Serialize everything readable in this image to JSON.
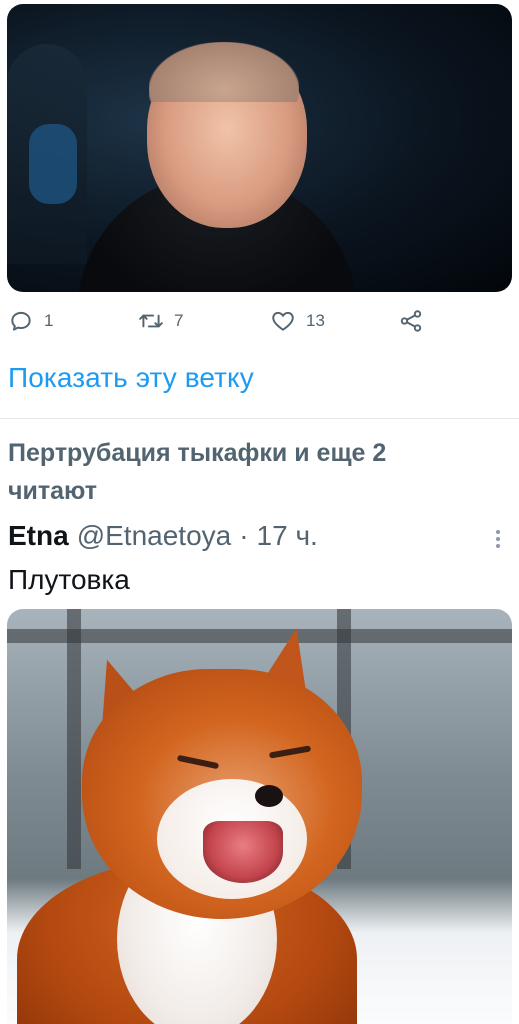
{
  "tweet_top": {
    "media_alt": "",
    "actions": {
      "reply_count": "1",
      "retweet_count": "7",
      "like_count": "13"
    },
    "show_thread": "Показать эту ветку"
  },
  "social_context": "Пертрубация тыкафки и еще 2 читают",
  "tweet": {
    "name": "Etna",
    "handle": "@Etnaetoya",
    "separator": "·",
    "time": "17 ч.",
    "text": "Плутовка"
  },
  "icons": {
    "reply": "reply-icon",
    "retweet": "retweet-icon",
    "like": "heart-icon",
    "share": "share-icon",
    "more": "more-vertical-icon"
  },
  "colors": {
    "link": "#1d9bf0",
    "secondary_text": "#536471",
    "primary_text": "#0f1419"
  }
}
